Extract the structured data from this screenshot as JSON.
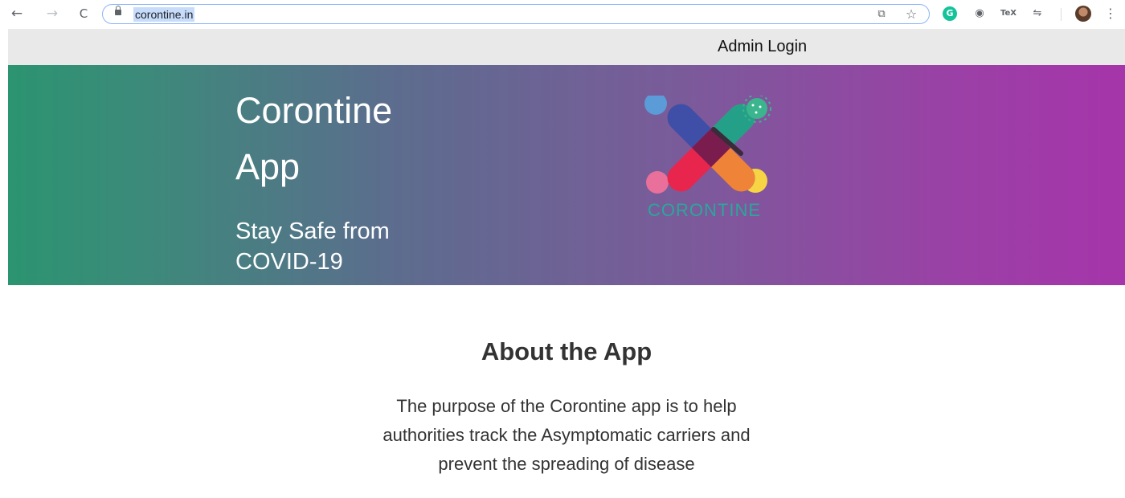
{
  "browser": {
    "back_icon": "←",
    "forward_icon": "→",
    "reload_icon": "C",
    "url": "corontine.in",
    "cast_icon": "⧉",
    "star_icon": "☆",
    "grammarly_icon": "G",
    "ext_circle_icon": "◉",
    "tex_icon": "TeX",
    "ext_icon": "⇋",
    "menu_icon": "⋮"
  },
  "topbar": {
    "admin_login": "Admin Login"
  },
  "hero": {
    "title_line1": "Corontine",
    "title_line2": "App",
    "subtitle_line1": "Stay Safe from",
    "subtitle_line2": "COVID-19",
    "logo_text": "CORONTINE"
  },
  "about": {
    "heading": "About the App",
    "line1": "The purpose of the Corontine app is to help",
    "line2": "authorities track the Asymptomatic carriers and",
    "line3": "prevent the spreading of disease"
  },
  "colors": {
    "hero_start": "#2b9470",
    "hero_end": "#a535aa",
    "logo_teal": "#2aa79b",
    "omnibox_border": "#8ab4f8"
  }
}
